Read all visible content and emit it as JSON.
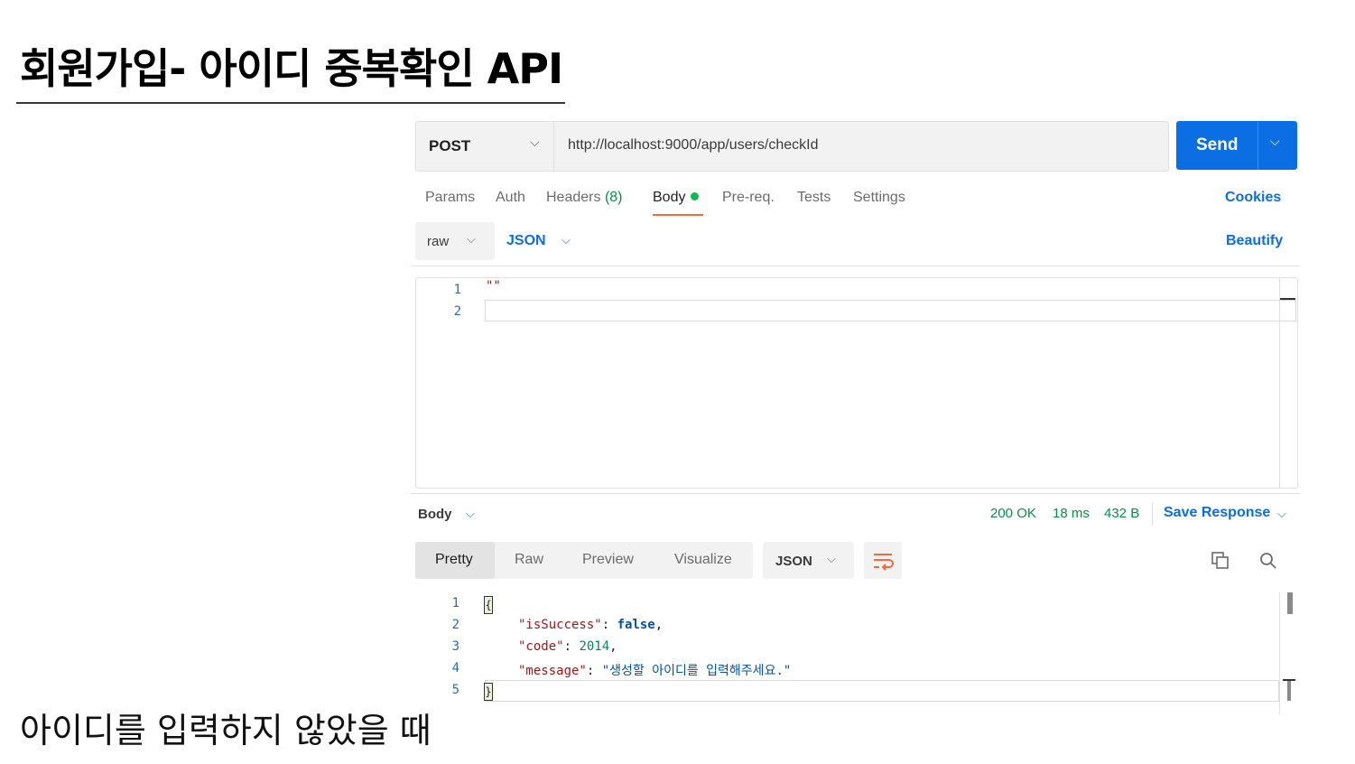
{
  "slide": {
    "title": "회원가입- 아이디 중복확인 API",
    "caption": "아이디를 입력하지 않았을 때"
  },
  "request": {
    "method": "POST",
    "url": "http://localhost:9000/app/users/checkId",
    "send_label": "Send",
    "tabs": {
      "params": "Params",
      "auth": "Auth",
      "headers": "Headers",
      "headers_count": "(8)",
      "body": "Body",
      "prereq": "Pre-req.",
      "tests": "Tests",
      "settings": "Settings"
    },
    "cookies_label": "Cookies",
    "body_mode": "raw",
    "body_format": "JSON",
    "beautify_label": "Beautify",
    "editor": {
      "line_numbers": [
        "1",
        "2"
      ],
      "line1": "\"\""
    }
  },
  "response": {
    "body_label": "Body",
    "status": "200 OK",
    "time": "18 ms",
    "size": "432 B",
    "save_label": "Save Response",
    "view_tabs": [
      "Pretty",
      "Raw",
      "Preview",
      "Visualize"
    ],
    "format": "JSON",
    "line_numbers": [
      "1",
      "2",
      "3",
      "4",
      "5"
    ],
    "open_brace": "{",
    "close_brace": "}",
    "fields": {
      "isSuccess_key": "\"isSuccess\"",
      "isSuccess_val": "false",
      "code_key": "\"code\"",
      "code_val": "2014",
      "message_key": "\"message\"",
      "message_val": "\"생성할 아이디를 입력해주세요.\""
    }
  },
  "colors": {
    "accent": "#0b6ee3",
    "status_ok": "#0a8d44",
    "active_tab_underline": "#f26b3a",
    "wrap_icon": "#f26b3a"
  },
  "icons": {
    "copy": "copy-icon",
    "search": "search-icon",
    "wrap": "wrap-lines-icon"
  }
}
